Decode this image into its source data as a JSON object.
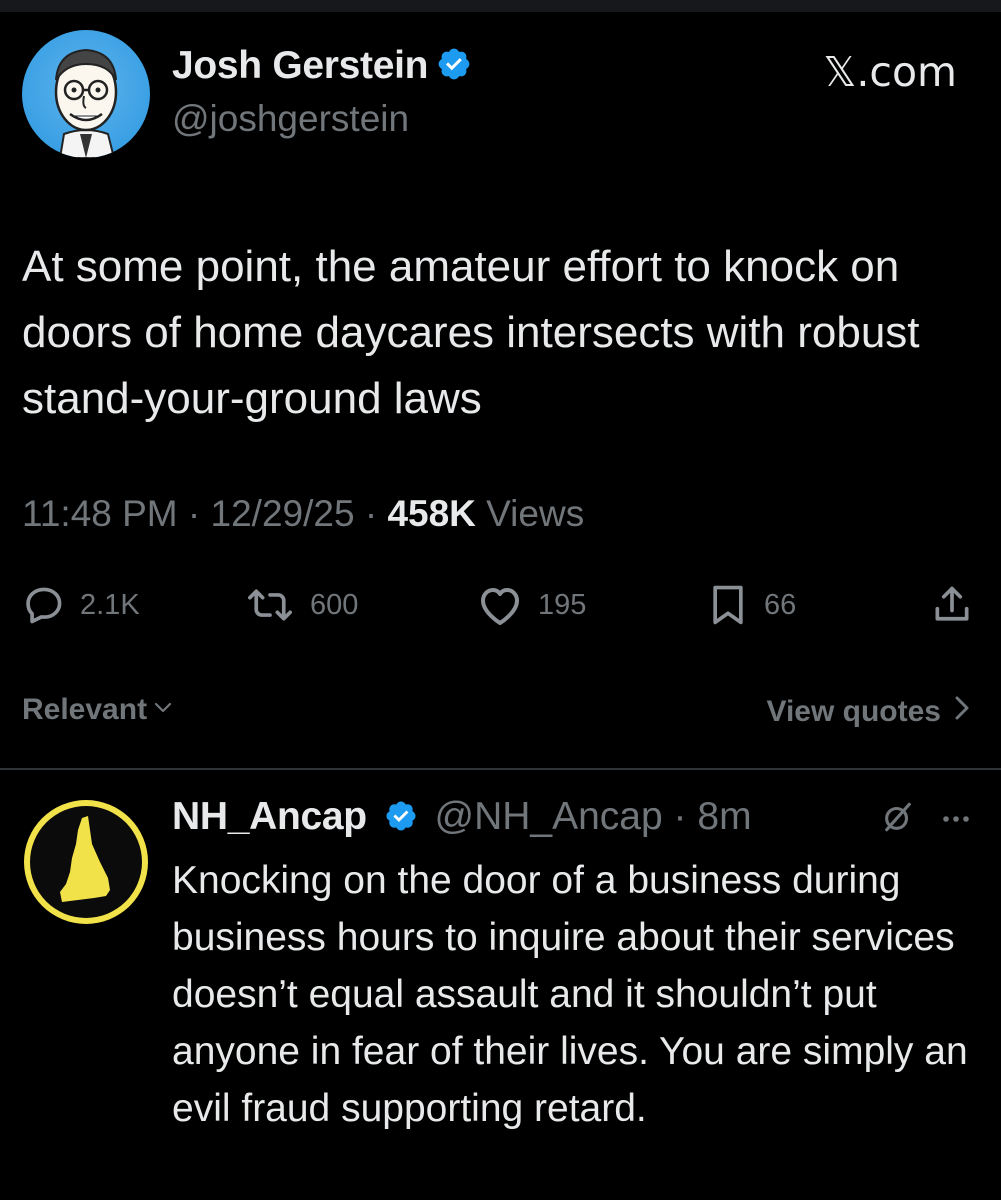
{
  "tweet": {
    "author": {
      "display_name": "Josh Gerstein",
      "handle": "@joshgerstein",
      "verified": true
    },
    "site_label": "𝕏.com",
    "text": "At some point, the amateur effort to knock on doors of home daycares intersects with robust stand-your-ground laws",
    "time": "11:48 PM",
    "date": "12/29/25",
    "views_count": "458K",
    "views_label": "Views",
    "stats": {
      "replies": "2.1K",
      "reposts": "600",
      "likes": "195",
      "bookmarks": "66"
    }
  },
  "controls": {
    "sort_label": "Relevant",
    "quotes_label": "View quotes"
  },
  "reply": {
    "display_name": "NH_Ancap",
    "handle": "@NH_Ancap",
    "time_ago": "8m",
    "text": "Knocking on the door of a business during business hours to inquire about their services doesn’t equal assault and it shouldn’t put anyone in fear of their lives. You are simply an evil fraud supporting retard."
  },
  "colors": {
    "background": "#000000",
    "primary_text": "#e7e9ea",
    "secondary_text": "#71767b",
    "verified_badge": "#1d9bf0",
    "divider": "#2f3336",
    "nh_logo": "#f2e24a"
  },
  "icons": [
    "verified-badge-icon",
    "reply-icon",
    "repost-icon",
    "like-icon",
    "bookmark-icon",
    "share-icon",
    "chevron-down-icon",
    "chevron-right-icon",
    "grok-icon",
    "more-icon"
  ]
}
